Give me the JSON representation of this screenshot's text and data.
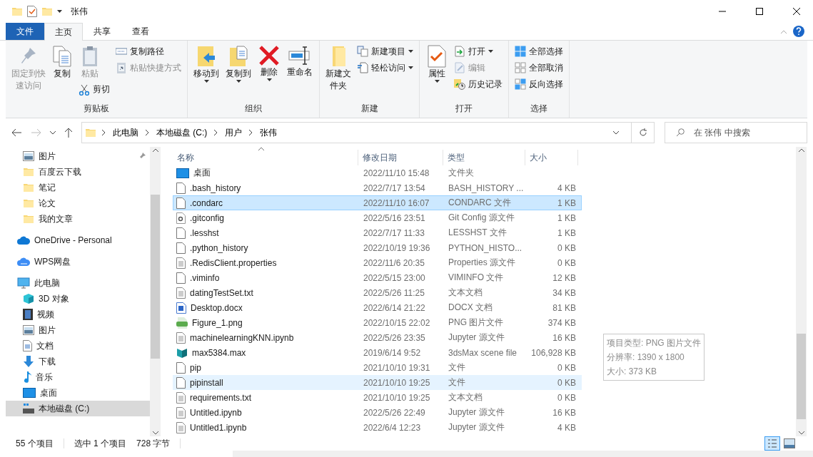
{
  "window": {
    "title": "张伟"
  },
  "ribbon_tabs": [
    {
      "label": "文件",
      "kind": "file",
      "selected": false
    },
    {
      "label": "主页",
      "kind": "tab",
      "selected": true
    },
    {
      "label": "共享",
      "kind": "tab",
      "selected": false
    },
    {
      "label": "查看",
      "kind": "tab",
      "selected": false
    }
  ],
  "ribbon_groups": [
    {
      "label": "剪贴板",
      "columns": [
        [
          {
            "label": "固定到快速访问",
            "kind": "large",
            "disabled": true,
            "dropdown": false
          }
        ],
        [
          {
            "label": "复制",
            "kind": "large",
            "disabled": false,
            "dropdown": false
          }
        ],
        [
          {
            "label": "粘贴",
            "kind": "large",
            "disabled": true,
            "dropdown": false
          },
          {
            "label": "剪切",
            "kind": "small",
            "disabled": false,
            "dropdown": false
          }
        ],
        [
          {
            "label": "复制路径",
            "kind": "small",
            "disabled": false,
            "dropdown": false
          },
          {
            "label": "粘贴快捷方式",
            "kind": "small",
            "disabled": true,
            "dropdown": false
          }
        ]
      ]
    },
    {
      "label": "组织",
      "columns": [
        [
          {
            "label": "移动到",
            "kind": "large",
            "disabled": false,
            "dropdown": true
          }
        ],
        [
          {
            "label": "复制到",
            "kind": "large",
            "disabled": false,
            "dropdown": true
          }
        ],
        [
          {
            "label": "删除",
            "kind": "large",
            "disabled": false,
            "dropdown": true
          }
        ],
        [
          {
            "label": "重命名",
            "kind": "large",
            "disabled": false,
            "dropdown": false
          }
        ]
      ]
    },
    {
      "label": "新建",
      "columns": [
        [
          {
            "label": "新建文件夹",
            "kind": "large",
            "disabled": false,
            "dropdown": false
          }
        ],
        [
          {
            "label": "新建项目",
            "kind": "small",
            "disabled": false,
            "dropdown": true
          },
          {
            "label": "轻松访问",
            "kind": "small",
            "disabled": false,
            "dropdown": true
          }
        ]
      ]
    },
    {
      "label": "打开",
      "columns": [
        [
          {
            "label": "属性",
            "kind": "large",
            "disabled": false,
            "dropdown": true
          }
        ],
        [
          {
            "label": "打开",
            "kind": "small",
            "disabled": false,
            "dropdown": true
          },
          {
            "label": "编辑",
            "kind": "small",
            "disabled": true,
            "dropdown": false
          },
          {
            "label": "历史记录",
            "kind": "small",
            "disabled": false,
            "dropdown": false
          }
        ]
      ]
    },
    {
      "label": "选择",
      "columns": [
        [
          {
            "label": "全部选择",
            "kind": "small",
            "disabled": false,
            "dropdown": false
          },
          {
            "label": "全部取消",
            "kind": "small",
            "disabled": false,
            "dropdown": false
          },
          {
            "label": "反向选择",
            "kind": "small",
            "disabled": false,
            "dropdown": false
          }
        ]
      ]
    }
  ],
  "breadcrumbs": [
    "此电脑",
    "本地磁盘 (C:)",
    "用户",
    "张伟"
  ],
  "search": {
    "placeholder": "在 张伟 中搜索"
  },
  "sidebar": {
    "quick_access": [
      {
        "label": "图片",
        "kind": "pictures",
        "pinned": true,
        "selected": false
      },
      {
        "label": "百度云下载",
        "kind": "folder",
        "pinned": false,
        "selected": false
      },
      {
        "label": "笔记",
        "kind": "folder",
        "pinned": false,
        "selected": false
      },
      {
        "label": "论文",
        "kind": "folder",
        "pinned": false,
        "selected": false
      },
      {
        "label": "我的文章",
        "kind": "folder",
        "pinned": false,
        "selected": false
      }
    ],
    "locations": [
      {
        "label": "OneDrive - Personal",
        "kind": "cloud",
        "selected": false
      },
      {
        "label": "WPS网盘",
        "kind": "cloud2",
        "selected": false
      },
      {
        "label": "此电脑",
        "kind": "pc",
        "selected": false,
        "children": [
          {
            "label": "3D 对象",
            "kind": "cube",
            "selected": false
          },
          {
            "label": "视频",
            "kind": "video",
            "selected": false
          },
          {
            "label": "图片",
            "kind": "pictures",
            "selected": false
          },
          {
            "label": "文档",
            "kind": "doc",
            "selected": false
          },
          {
            "label": "下载",
            "kind": "download",
            "selected": false
          },
          {
            "label": "音乐",
            "kind": "music",
            "selected": false
          },
          {
            "label": "桌面",
            "kind": "desktop",
            "selected": false
          },
          {
            "label": "本地磁盘 (C:)",
            "kind": "drive",
            "selected": true
          }
        ]
      }
    ]
  },
  "columns": [
    "名称",
    "修改日期",
    "类型",
    "大小"
  ],
  "files": [
    {
      "name": "桌面",
      "kind": "desktop",
      "date": "2022/11/10 15:48",
      "type": "文件夹",
      "selected": false,
      "hovered": false
    },
    {
      "name": ".bash_history",
      "kind": "blank",
      "date": "2022/7/17 13:54",
      "type": "BASH_HISTORY ...",
      "size": "4 KB",
      "selected": false,
      "hovered": false
    },
    {
      "name": ".condarc",
      "kind": "blank",
      "date": "2022/11/10 16:07",
      "type": "CONDARC 文件",
      "size": "1 KB",
      "selected": true,
      "hovered": false
    },
    {
      "name": ".gitconfig",
      "kind": "gear",
      "date": "2022/5/16 23:51",
      "type": "Git Config 源文件",
      "size": "1 KB",
      "selected": false,
      "hovered": false
    },
    {
      "name": ".lesshst",
      "kind": "blank",
      "date": "2022/7/17 11:33",
      "type": "LESSHST 文件",
      "size": "1 KB",
      "selected": false,
      "hovered": false
    },
    {
      "name": ".python_history",
      "kind": "blank",
      "date": "2022/10/19 19:36",
      "type": "PYTHON_HISTO...",
      "size": "0 KB",
      "selected": false,
      "hovered": false
    },
    {
      "name": ".RedisClient.properties",
      "kind": "text",
      "date": "2022/11/6 20:35",
      "type": "Properties 源文件",
      "size": "0 KB",
      "selected": false,
      "hovered": false
    },
    {
      "name": ".viminfo",
      "kind": "blank",
      "date": "2022/5/15 23:00",
      "type": "VIMINFO 文件",
      "size": "12 KB",
      "selected": false,
      "hovered": false
    },
    {
      "name": "datingTestSet.txt",
      "kind": "text",
      "date": "2022/5/26 11:25",
      "type": "文本文档",
      "size": "34 KB",
      "selected": false,
      "hovered": false
    },
    {
      "name": "Desktop.docx",
      "kind": "word",
      "date": "2022/6/14 21:22",
      "type": "DOCX 文档",
      "size": "81 KB",
      "selected": false,
      "hovered": false
    },
    {
      "name": "Figure_1.png",
      "kind": "png",
      "date": "2022/10/15 22:02",
      "type": "PNG 图片文件",
      "size": "374 KB",
      "selected": false,
      "hovered": false
    },
    {
      "name": "machinelearningKNN.ipynb",
      "kind": "text",
      "date": "2022/5/26 23:35",
      "type": "Jupyter 源文件",
      "size": "16 KB",
      "selected": false,
      "hovered": false
    },
    {
      "name": "max5384.max",
      "kind": "max",
      "date": "2019/6/14 9:52",
      "type": "3dsMax scene file",
      "size": "106,928 KB",
      "selected": false,
      "hovered": false
    },
    {
      "name": "pip",
      "kind": "blank",
      "date": "2021/10/10 19:31",
      "type": "文件",
      "size": "0 KB",
      "selected": false,
      "hovered": false
    },
    {
      "name": "pipinstall",
      "kind": "blank",
      "date": "2021/10/10 19:25",
      "type": "文件",
      "size": "0 KB",
      "selected": false,
      "hovered": true
    },
    {
      "name": "requirements.txt",
      "kind": "text",
      "date": "2021/10/10 19:25",
      "type": "文本文档",
      "size": "0 KB",
      "selected": false,
      "hovered": false
    },
    {
      "name": "Untitled.ipynb",
      "kind": "text",
      "date": "2022/5/26 22:49",
      "type": "Jupyter 源文件",
      "size": "16 KB",
      "selected": false,
      "hovered": false
    },
    {
      "name": "Untitled1.ipynb",
      "kind": "text",
      "date": "2022/6/4 12:23",
      "type": "Jupyter 源文件",
      "size": "4 KB",
      "selected": false,
      "hovered": false
    }
  ],
  "tooltip": [
    "项目类型: PNG 图片文件",
    "分辨率: 1390 x 1800",
    "大小: 373 KB"
  ],
  "status_bar": {
    "count": "55 个项目",
    "selection": "选中 1 个项目",
    "size": "728 字节"
  },
  "view_buttons": [
    {
      "kind": "details",
      "selected": true
    },
    {
      "kind": "tiles",
      "selected": false
    }
  ]
}
